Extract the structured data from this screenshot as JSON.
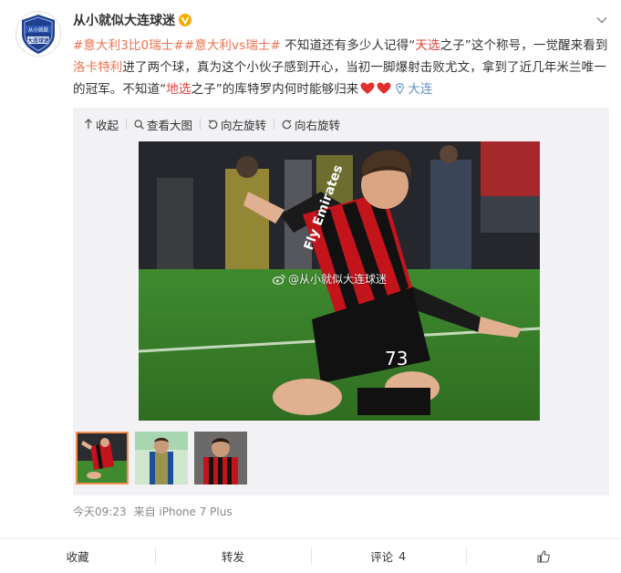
{
  "author": {
    "name": "从小就似大连球迷",
    "avatar_text": "从小就是大连球迷"
  },
  "post": {
    "tag1": "#意大利3比0瑞士#",
    "tag2": "#意大利vs瑞士#",
    "text1": " 不知道还有多少人记得“",
    "highlight1": "天选",
    "text2": "之子”这个称号，一觉醒来看到",
    "mention": "洛卡特利",
    "text3": "进了两个球，真为这个小伙子感到开心，当初一脚爆射击败尤文，拿到了近几年米兰唯一的冠军。不知道“",
    "highlight2": "地选",
    "text4": "之子”的库特罗内何时能够归来",
    "location": "大连"
  },
  "toolbar": {
    "collapse": "收起",
    "view_large": "查看大图",
    "rotate_left": "向左旋转",
    "rotate_right": "向右旋转"
  },
  "photo": {
    "watermark": "@从小就似大连球迷",
    "shirt_sponsor": "Fly Emirates",
    "shirt_number": "73"
  },
  "meta": {
    "time": "今天09:23",
    "source": "来自 iPhone 7 Plus"
  },
  "actions": {
    "favorite": "收藏",
    "repost": "转发",
    "comment": "评论",
    "comment_count": "4"
  },
  "colors": {
    "link": "#eb7350",
    "highlight": "#e2413b",
    "location": "#5d8fc6",
    "thumb_border": "#f19150"
  }
}
